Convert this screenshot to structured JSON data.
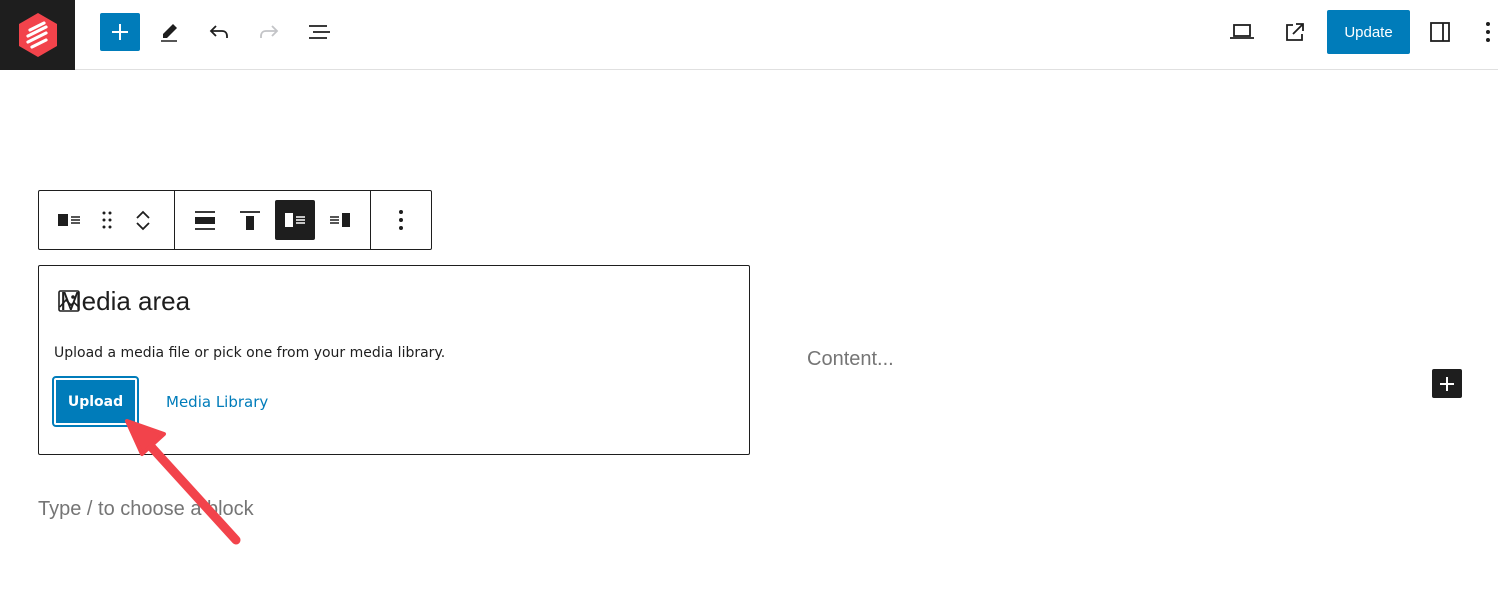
{
  "header": {
    "logo_icon": "brand-logo-icon",
    "inserter_icon": "plus-icon",
    "tools_icon": "pencil-icon",
    "undo_icon": "undo-icon",
    "redo_icon": "redo-icon",
    "list_view_icon": "list-view-icon",
    "preview_icon": "laptop-icon",
    "view_post_icon": "external-link-icon",
    "update_label": "Update",
    "settings_icon": "sidebar-toggle-icon",
    "options_icon": "vertical-ellipsis-icon",
    "accent_color": "#007cba"
  },
  "block_toolbar": {
    "block_type_icon": "media-text-icon",
    "drag_icon": "drag-handle-icon",
    "move_up_icon": "chevron-up-icon",
    "move_down_icon": "chevron-down-icon",
    "align_icons": [
      "align-wide-icon",
      "align-top-icon",
      "media-left-icon",
      "media-right-icon"
    ],
    "active_align": "media-left-icon",
    "more_icon": "vertical-ellipsis-icon"
  },
  "media": {
    "icon": "image-icon",
    "title": "Media area",
    "instructions": "Upload a media file or pick one from your media library.",
    "upload_label": "Upload",
    "library_label": "Media Library"
  },
  "content": {
    "placeholder": "Content...",
    "add_icon": "plus-icon"
  },
  "editor": {
    "default_placeholder": "Type / to choose a block"
  },
  "annotation": {
    "arrow_color": "#f2434b"
  }
}
